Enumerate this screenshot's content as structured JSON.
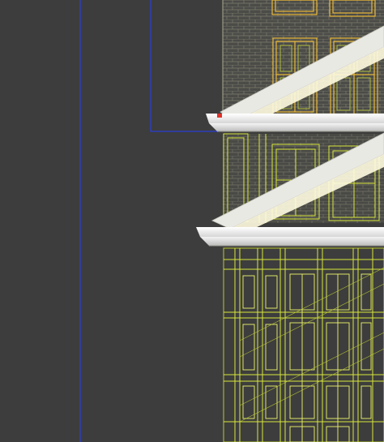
{
  "viewport": {
    "background_color": "#3d3d3d",
    "wireframe_color": "#d8e63a",
    "selected_wire_color": "#f2ff6a",
    "brick_line_color": "#8a8a74",
    "guide_line_color": "#2a3fd6",
    "cornice_color": "#f2f2f2",
    "marker_color": "#e0322a"
  }
}
